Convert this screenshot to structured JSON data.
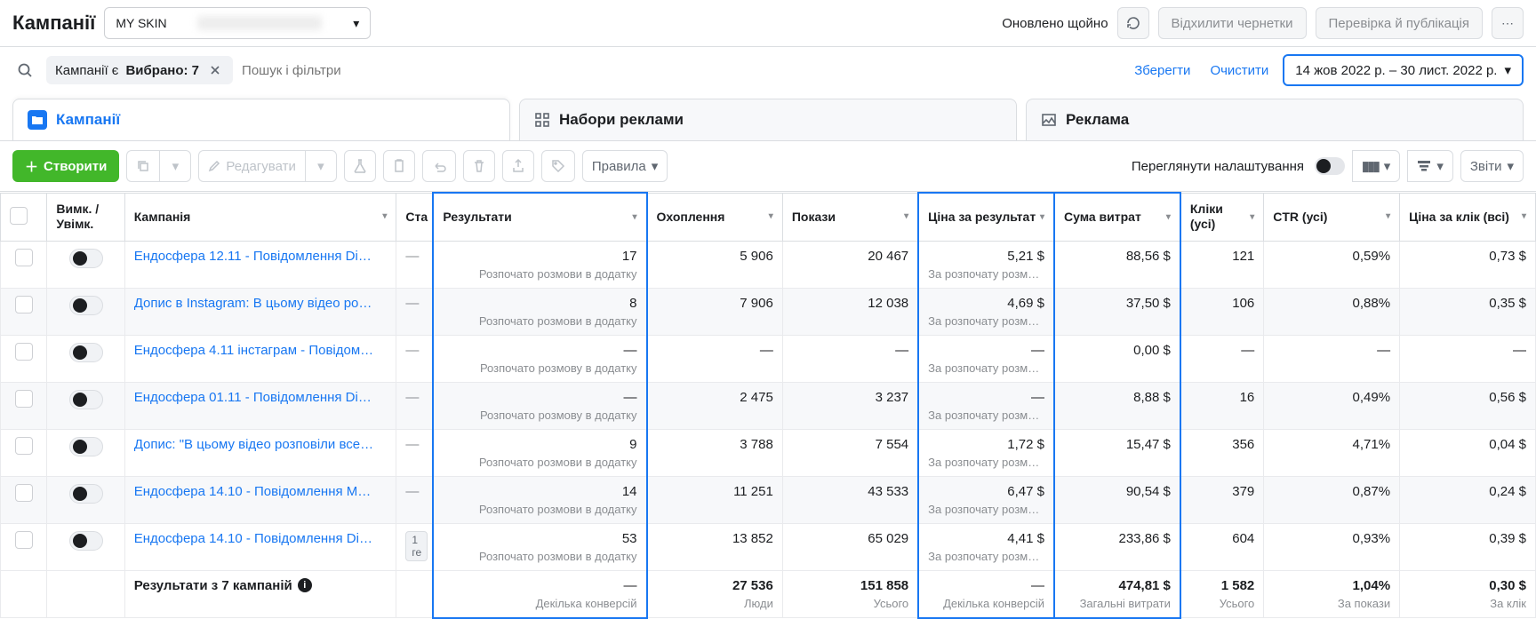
{
  "header": {
    "title": "Кампанії",
    "account_name": "MY SKIN",
    "updated_label": "Оновлено щойно",
    "discard_drafts": "Відхилити чернетки",
    "review_publish": "Перевірка й публікація"
  },
  "filter": {
    "chip_label": "Кампанії є",
    "chip_value": "Вибрано: 7",
    "placeholder": "Пошук і фільтри",
    "save": "Зберегти",
    "clear": "Очистити",
    "date_range": "14 жов 2022 р. – 30 лист. 2022 р."
  },
  "tabs": {
    "campaigns": "Кампанії",
    "adsets": "Набори реклами",
    "ads": "Реклама"
  },
  "toolbar": {
    "create": "Створити",
    "edit": "Редагувати",
    "rules": "Правила",
    "view_settings": "Переглянути налаштування",
    "reports": "Звіти"
  },
  "columns": {
    "toggle": "Вимк. / Увімк.",
    "campaign": "Кампанія",
    "status": "Ста",
    "results": "Результати",
    "reach": "Охоплення",
    "impressions": "Покази",
    "cost_per_result": "Ціна за результат",
    "spend": "Сума витрат",
    "clicks": "Кліки (усі)",
    "ctr": "CTR (усі)",
    "cpc": "Ціна за клік (всі)"
  },
  "rows": [
    {
      "name": "Ендосфера 12.11 - Повідомлення Di…",
      "status": "—",
      "results": "17",
      "results_sub": "Розпочато розмови в додатку",
      "reach": "5 906",
      "impressions": "20 467",
      "cpr": "5,21 $",
      "cpr_sub": "За розпочату розмо…",
      "spend": "88,56 $",
      "clicks": "121",
      "ctr": "0,59%",
      "cpc": "0,73 $"
    },
    {
      "name": "Допис в Instagram: В цьому відео ро…",
      "status": "—",
      "results": "8",
      "results_sub": "Розпочато розмови в додатку",
      "reach": "7 906",
      "impressions": "12 038",
      "cpr": "4,69 $",
      "cpr_sub": "За розпочату розмо…",
      "spend": "37,50 $",
      "clicks": "106",
      "ctr": "0,88%",
      "cpc": "0,35 $"
    },
    {
      "name": "Ендосфера 4.11 інстаграм - Повідом…",
      "status": "—",
      "results": "—",
      "results_sub": "Розпочато розмову в додатку",
      "reach": "—",
      "impressions": "—",
      "cpr": "—",
      "cpr_sub": "За розпочату розмо…",
      "spend": "0,00 $",
      "clicks": "—",
      "ctr": "—",
      "cpc": "—"
    },
    {
      "name": "Ендосфера 01.11 - Повідомлення Di…",
      "status": "—",
      "results": "—",
      "results_sub": "Розпочато розмову в додатку",
      "reach": "2 475",
      "impressions": "3 237",
      "cpr": "—",
      "cpr_sub": "За розпочату розмо…",
      "spend": "8,88 $",
      "clicks": "16",
      "ctr": "0,49%",
      "cpc": "0,56 $"
    },
    {
      "name": "Допис: \"В цьому відео розповіли все…",
      "status": "—",
      "results": "9",
      "results_sub": "Розпочато розмови в додатку",
      "reach": "3 788",
      "impressions": "7 554",
      "cpr": "1,72 $",
      "cpr_sub": "За розпочату розмо…",
      "spend": "15,47 $",
      "clicks": "356",
      "ctr": "4,71%",
      "cpc": "0,04 $"
    },
    {
      "name": "Ендосфера 14.10 - Повідомлення M…",
      "status": "—",
      "results": "14",
      "results_sub": "Розпочато розмови в додатку",
      "reach": "11 251",
      "impressions": "43 533",
      "cpr": "6,47 $",
      "cpr_sub": "За розпочату розмо…",
      "spend": "90,54 $",
      "clicks": "379",
      "ctr": "0,87%",
      "cpc": "0,24 $"
    },
    {
      "name": "Ендосфера 14.10 - Повідомлення Di…",
      "status_badge": "1 ге",
      "results": "53",
      "results_sub": "Розпочато розмови в додатку",
      "reach": "13 852",
      "impressions": "65 029",
      "cpr": "4,41 $",
      "cpr_sub": "За розпочату розмо…",
      "spend": "233,86 $",
      "clicks": "604",
      "ctr": "0,93%",
      "cpc": "0,39 $"
    }
  ],
  "summary": {
    "title": "Результати з 7 кампаній",
    "results": "—",
    "results_sub": "Декілька конверсій",
    "reach": "27 536",
    "reach_sub": "Люди",
    "impressions": "151 858",
    "impressions_sub": "Усього",
    "cpr": "—",
    "cpr_sub": "Декілька конверсій",
    "spend": "474,81 $",
    "spend_sub": "Загальні витрати",
    "clicks": "1 582",
    "clicks_sub": "Усього",
    "ctr": "1,04%",
    "ctr_sub": "За покази",
    "cpc": "0,30 $",
    "cpc_sub": "За клік"
  }
}
